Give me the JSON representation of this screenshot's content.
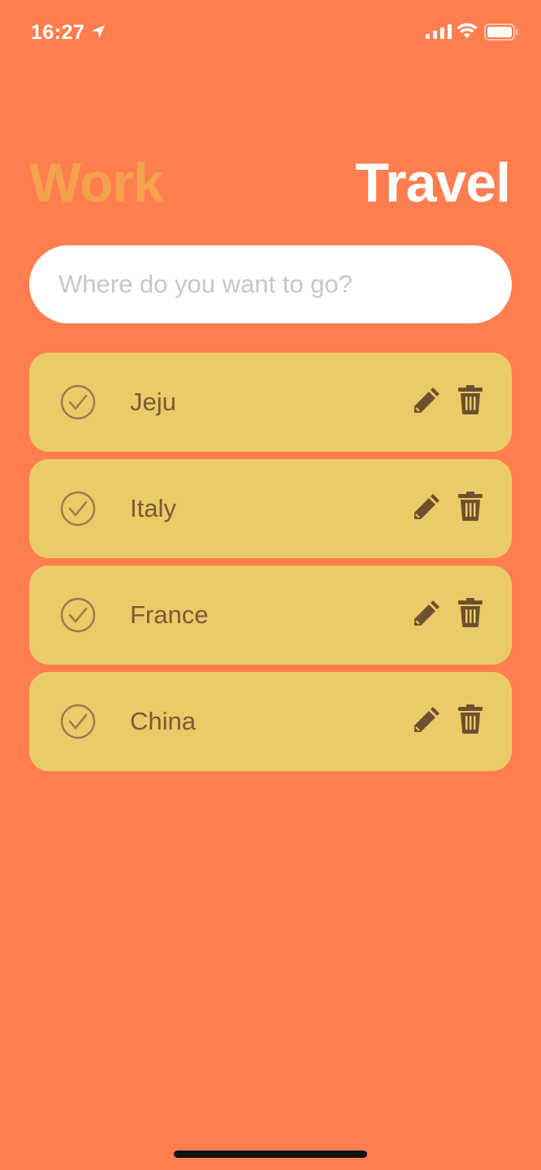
{
  "status_bar": {
    "time": "16:27",
    "icons": [
      "location-arrow-icon",
      "signal-icon",
      "wifi-icon",
      "battery-icon"
    ]
  },
  "header": {
    "tabs": [
      {
        "label": "Work",
        "active": false,
        "color": "#F5A24C"
      },
      {
        "label": "Travel",
        "active": true,
        "color": "#FFFFFF"
      }
    ]
  },
  "input": {
    "value": "",
    "placeholder": "Where do you want to go?"
  },
  "todos": [
    {
      "text": "Jeju"
    },
    {
      "text": "Italy"
    },
    {
      "text": "France"
    },
    {
      "text": "China"
    }
  ],
  "colors": {
    "background": "#FF7E4F",
    "card": "#EBCB68",
    "card_text": "#7A5A32",
    "icon": "#6E4F2E"
  }
}
